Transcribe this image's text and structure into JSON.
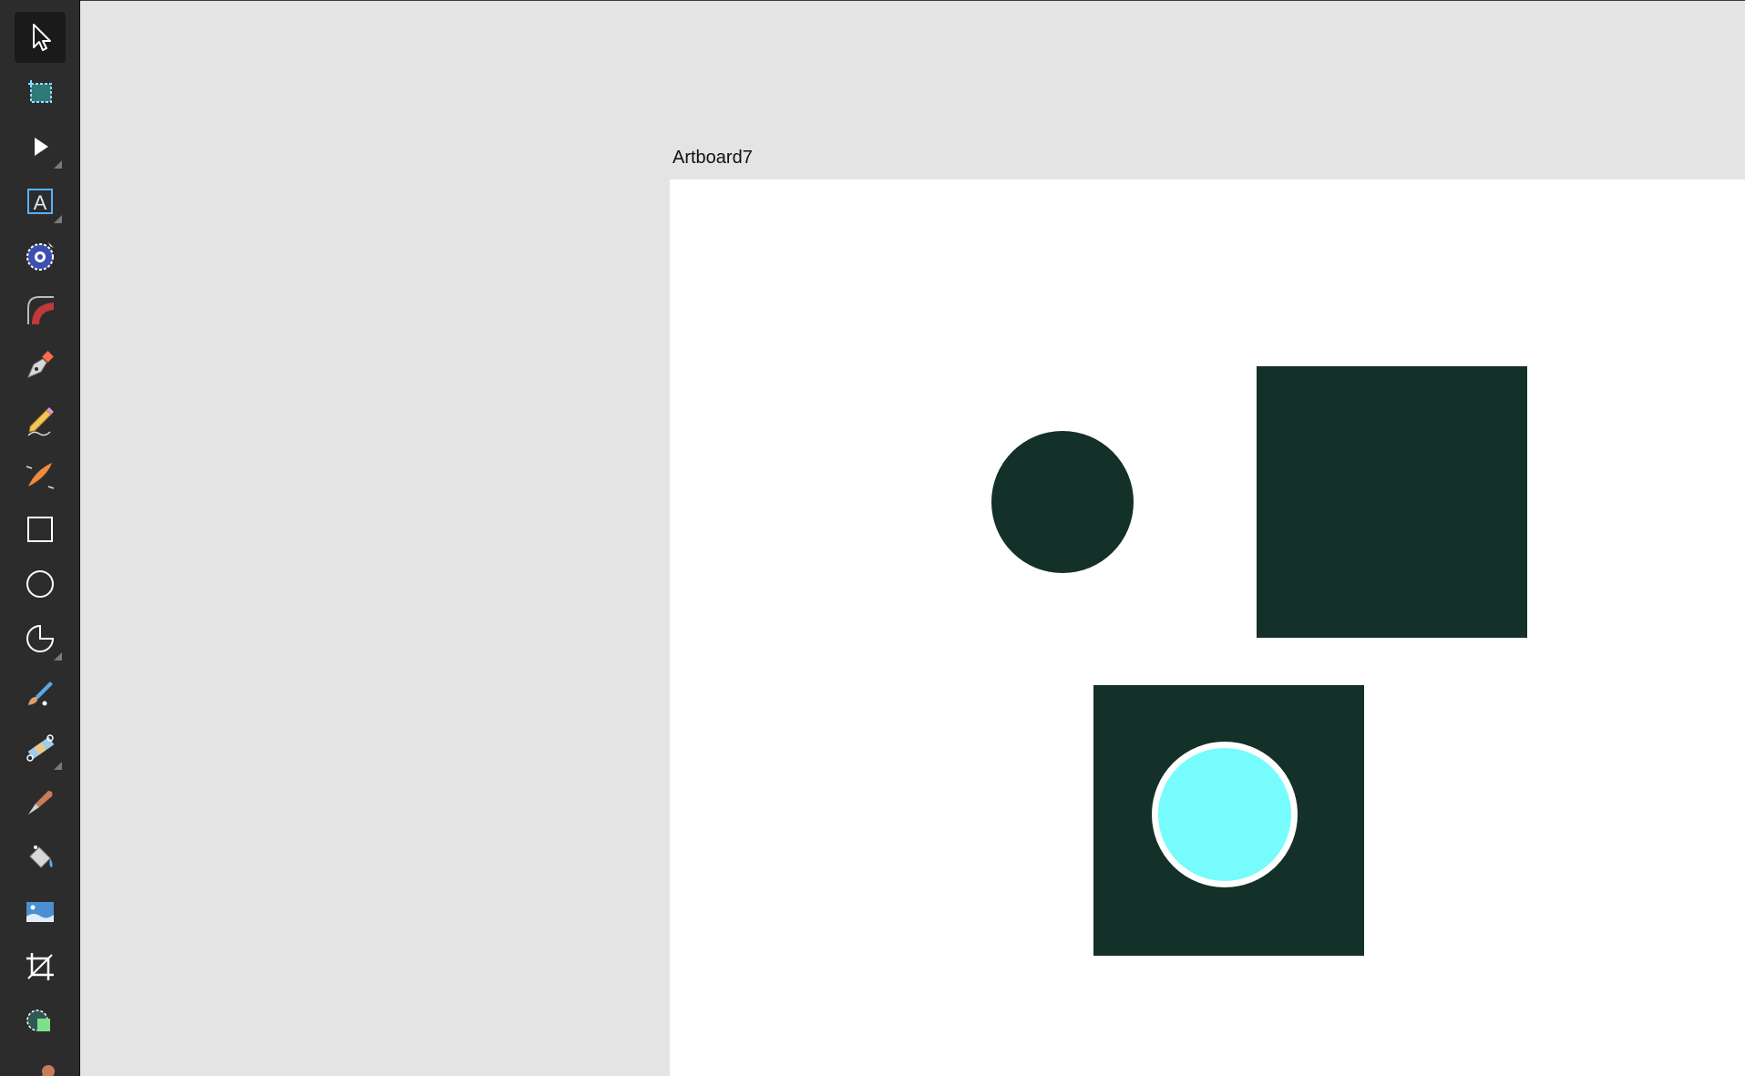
{
  "artboard": {
    "name": "Artboard7",
    "background": "#ffffff"
  },
  "colors": {
    "toolbar_bg": "#2c2c2c",
    "canvas_bg": "#e4e4e4",
    "shape_dark": "#133029",
    "shape_cyan": "#76fcfc",
    "stroke_white": "#ffffff"
  },
  "toolbar": {
    "tools": [
      {
        "name": "move-tool-icon",
        "active": true
      },
      {
        "name": "artboard-tool-icon",
        "active": false
      },
      {
        "name": "node-tool-icon",
        "active": false
      },
      {
        "name": "frame-text-tool-icon",
        "active": false
      },
      {
        "name": "contour-tool-icon",
        "active": false
      },
      {
        "name": "corner-tool-icon",
        "active": false
      },
      {
        "name": "pen-tool-icon",
        "active": false
      },
      {
        "name": "pencil-tool-icon",
        "active": false
      },
      {
        "name": "vector-brush-tool-icon",
        "active": false
      },
      {
        "name": "rectangle-tool-icon",
        "active": false
      },
      {
        "name": "ellipse-tool-icon",
        "active": false
      },
      {
        "name": "pie-tool-icon",
        "active": false
      },
      {
        "name": "paint-brush-tool-icon",
        "active": false
      },
      {
        "name": "transparency-tool-icon",
        "active": false
      },
      {
        "name": "pixel-brush-tool-icon",
        "active": false
      },
      {
        "name": "fill-tool-icon",
        "active": false
      },
      {
        "name": "place-image-tool-icon",
        "active": false
      },
      {
        "name": "crop-tool-icon",
        "active": false
      },
      {
        "name": "shape-builder-tool-icon",
        "active": false
      },
      {
        "name": "color-picker-tool-icon",
        "active": false
      }
    ]
  }
}
